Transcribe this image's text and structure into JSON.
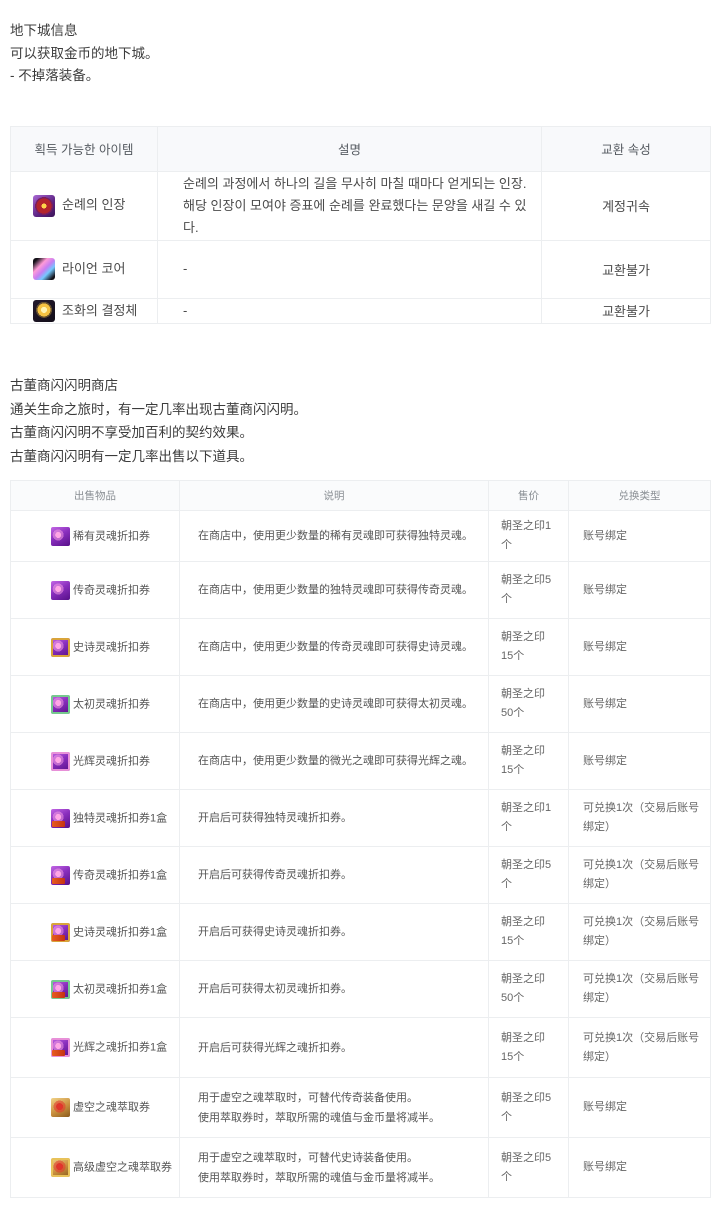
{
  "colors": {
    "page_bg": "#ffffff",
    "table_border": "#eceef0",
    "table_header_bg": "#f8f9fb",
    "text_primary": "#3c3c3c",
    "text_muted": "#8a8f94"
  },
  "dungeon_info": {
    "title": "地下城信息",
    "lines": [
      "可以获取金币的地下城。",
      "- 不掉落装备。"
    ]
  },
  "item_table": {
    "headers": [
      "획득 가능한 아이템",
      "설명",
      "교환 속성"
    ],
    "rows": [
      {
        "icon": "pilgrim-seal",
        "name": "순례의 인장",
        "desc": "순례의 과정에서 하나의 길을 무사히 마칠 때마다 얻게되는 인장.\n해당 인장이 모여야 증표에 순례를 완료했다는 문양을 새길 수 있다.",
        "attr": "계정귀속"
      },
      {
        "icon": "lion-core",
        "name": "라이언 코어",
        "desc": "-",
        "attr": "교환불가"
      },
      {
        "icon": "harmony-crystal",
        "name": "조화의 결정체",
        "desc": "-",
        "attr": "교환불가"
      }
    ]
  },
  "shop_info": {
    "title": "古董商闪闪明商店",
    "lines": [
      "通关生命之旅时，有一定几率出现古董商闪闪明。",
      "古董商闪闪明不享受加百利的契约效果。",
      "古董商闪闪明有一定几率出售以下道具。"
    ]
  },
  "shop_table": {
    "headers": [
      "出售物品",
      "说明",
      "售价",
      "兑换类型"
    ],
    "rows": [
      {
        "icon": "ticket-rare",
        "name": "稀有灵魂折扣券",
        "desc": "在商店中，使用更少数量的稀有灵魂即可获得独特灵魂。",
        "price": "朝圣之印1\n个",
        "type": "账号绑定"
      },
      {
        "icon": "ticket-legend",
        "name": "传奇灵魂折扣券",
        "desc": "在商店中，使用更少数量的独特灵魂即可获得传奇灵魂。",
        "price": "朝圣之印5\n个",
        "type": "账号绑定"
      },
      {
        "icon": "ticket-epic",
        "name": "史诗灵魂折扣券",
        "desc": "在商店中，使用更少数量的传奇灵魂即可获得史诗灵魂。",
        "price": "朝圣之印\n15个",
        "type": "账号绑定"
      },
      {
        "icon": "ticket-primeval",
        "name": "太初灵魂折扣券",
        "desc": "在商店中，使用更少数量的史诗灵魂即可获得太初灵魂。",
        "price": "朝圣之印\n50个",
        "type": "账号绑定"
      },
      {
        "icon": "ticket-radiant",
        "name": "光辉灵魂折扣券",
        "desc": "在商店中，使用更少数量的微光之魂即可获得光辉之魂。",
        "price": "朝圣之印\n15个",
        "type": "账号绑定"
      },
      {
        "icon": "box-unique",
        "name": "独特灵魂折扣券1盒",
        "desc": "开启后可获得独特灵魂折扣券。",
        "price": "朝圣之印1\n个",
        "type": "可兑换1次（交易后账号绑定）"
      },
      {
        "icon": "box-legend",
        "name": "传奇灵魂折扣券1盒",
        "desc": "开启后可获得传奇灵魂折扣券。",
        "price": "朝圣之印5\n个",
        "type": "可兑换1次（交易后账号绑定）"
      },
      {
        "icon": "box-epic",
        "name": "史诗灵魂折扣券1盒",
        "desc": "开启后可获得史诗灵魂折扣券。",
        "price": "朝圣之印\n15个",
        "type": "可兑换1次（交易后账号绑定）"
      },
      {
        "icon": "box-primeval",
        "name": "太初灵魂折扣券1盒",
        "desc": "开启后可获得太初灵魂折扣券。",
        "price": "朝圣之印\n50个",
        "type": "可兑换1次（交易后账号绑定）"
      },
      {
        "icon": "box-radiant",
        "name": "光辉之魂折扣券1盒",
        "desc": "开启后可获得光辉之魂折扣券。",
        "price": "朝圣之印\n15个",
        "type": "可兑换1次（交易后账号绑定）"
      },
      {
        "icon": "extract-ticket",
        "name": "虚空之魂萃取券",
        "desc": "用于虚空之魂萃取时，可替代传奇装备使用。\n使用萃取券时，萃取所需的魂值与金币量将减半。",
        "price": "朝圣之印5\n个",
        "type": "账号绑定"
      },
      {
        "icon": "extract-ticket-advanced",
        "name": "高级虚空之魂萃取券",
        "desc": "用于虚空之魂萃取时，可替代史诗装备使用。\n使用萃取券时，萃取所需的魂值与金币量将减半。",
        "price": "朝圣之印5\n个",
        "type": "账号绑定"
      }
    ]
  }
}
